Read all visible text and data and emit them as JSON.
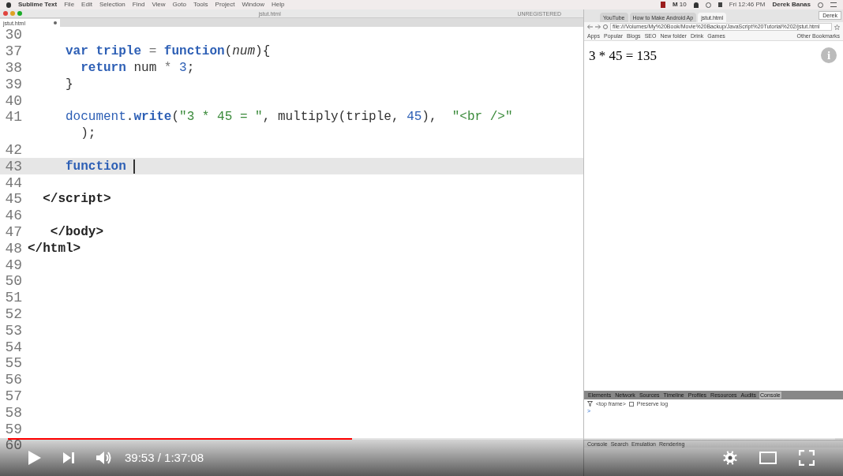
{
  "menu_bar": {
    "app": "Sublime Text",
    "items": [
      "File",
      "Edit",
      "Selection",
      "Find",
      "View",
      "Goto",
      "Tools",
      "Project",
      "Window",
      "Help"
    ],
    "mail": "M",
    "badge": "10",
    "clock": "Fri 12:46 PM",
    "user": "Derek Banas"
  },
  "editor": {
    "title": "jstut.html",
    "license": "UNREGISTERED",
    "tab": "jstut.html",
    "lines": [
      {
        "number": "30",
        "current": false
      },
      {
        "number": "37",
        "current": false,
        "tokens": [
          {
            "kind": "keyword",
            "text": "     var "
          },
          {
            "kind": "name",
            "text": "triple"
          },
          {
            "kind": "operator",
            "text": " = "
          },
          {
            "kind": "keyword",
            "text": "function"
          },
          {
            "kind": "plain",
            "text": "("
          },
          {
            "kind": "param",
            "text": "num"
          },
          {
            "kind": "plain",
            "text": "){"
          }
        ]
      },
      {
        "number": "38",
        "current": false,
        "tokens": [
          {
            "kind": "keyword",
            "text": "       return"
          },
          {
            "kind": "plain",
            "text": " num "
          },
          {
            "kind": "operator",
            "text": "* "
          },
          {
            "kind": "number",
            "text": "3"
          },
          {
            "kind": "plain",
            "text": ";"
          }
        ]
      },
      {
        "number": "39",
        "current": false,
        "tokens": [
          {
            "kind": "plain",
            "text": "     }"
          }
        ]
      },
      {
        "number": "40",
        "current": false
      },
      {
        "number": "41",
        "current": false,
        "tokens": [
          {
            "kind": "function",
            "text": "     document"
          },
          {
            "kind": "plain",
            "text": "."
          },
          {
            "kind": "keyword",
            "text": "write"
          },
          {
            "kind": "plain",
            "text": "("
          },
          {
            "kind": "string",
            "text": "\"3 * 45 = \""
          },
          {
            "kind": "plain",
            "text": ", multiply(triple, "
          },
          {
            "kind": "number",
            "text": "45"
          },
          {
            "kind": "plain",
            "text": "),  "
          },
          {
            "kind": "string",
            "text": "\"<br />\""
          }
        ],
        "wrapped": [
          {
            "kind": "plain",
            "text": "       );"
          }
        ]
      },
      {
        "number": "42",
        "current": false
      },
      {
        "number": "43",
        "current": true,
        "tokens": [
          {
            "kind": "keyword",
            "text": "     function "
          }
        ]
      },
      {
        "number": "44",
        "current": false
      },
      {
        "number": "45",
        "current": false,
        "tokens": [
          {
            "kind": "tag",
            "text": "  </script>"
          }
        ]
      },
      {
        "number": "46",
        "current": false
      },
      {
        "number": "47",
        "current": false,
        "tokens": [
          {
            "kind": "tag",
            "text": "   </body>"
          }
        ]
      },
      {
        "number": "48",
        "current": false,
        "tokens": [
          {
            "kind": "tag",
            "text": "</html>"
          }
        ]
      },
      {
        "number": "49",
        "current": false
      },
      {
        "number": "50",
        "current": false
      },
      {
        "number": "51",
        "current": false
      },
      {
        "number": "52",
        "current": false
      },
      {
        "number": "53",
        "current": false
      },
      {
        "number": "54",
        "current": false
      },
      {
        "number": "55",
        "current": false
      },
      {
        "number": "56",
        "current": false
      },
      {
        "number": "57",
        "current": false
      },
      {
        "number": "58",
        "current": false
      },
      {
        "number": "59",
        "current": false
      },
      {
        "number": "60",
        "current": false
      }
    ]
  },
  "browser": {
    "tabs": [
      {
        "label": "YouTube",
        "selected": false
      },
      {
        "label": "How to Make Android Ap",
        "selected": false
      },
      {
        "label": "jstut.html",
        "selected": true
      }
    ],
    "profile": "Derek",
    "address": "file:///Volumes/My%20Book/Movie%20Backup/JavaScript%20Tutorial%202/jstut.html",
    "bookmarks": [
      "Apps",
      "Popular",
      "Blogs",
      "SEO",
      "New folder",
      "Drink",
      "Games"
    ],
    "other_bookmarks": "Other Bookmarks",
    "content": "3 * 45 = 135",
    "devtools": {
      "tabs": [
        {
          "label": "Elements",
          "selected": false
        },
        {
          "label": "Network",
          "selected": false
        },
        {
          "label": "Sources",
          "selected": false
        },
        {
          "label": "Timeline",
          "selected": false
        },
        {
          "label": "Profiles",
          "selected": false
        },
        {
          "label": "Resources",
          "selected": false
        },
        {
          "label": "Audits",
          "selected": false
        },
        {
          "label": "Console",
          "selected": true
        }
      ],
      "frame": "<top frame>",
      "preserve_log": {
        "label": "Preserve log",
        "checked": false
      },
      "prompt": ">",
      "drawer_tabs": [
        "Console",
        "Search",
        "Emulation",
        "Rendering"
      ]
    }
  },
  "player": {
    "progress": {
      "level": 0.416
    },
    "time": "39:53 / 1:37:08",
    "info": "i"
  }
}
